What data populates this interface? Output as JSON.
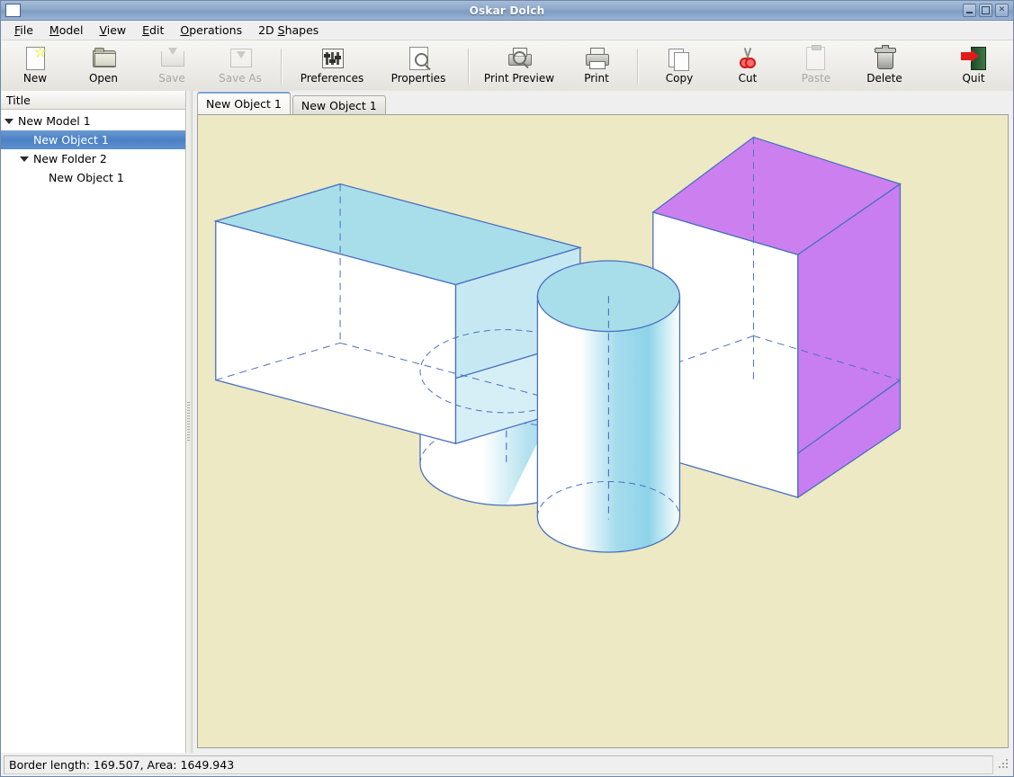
{
  "window": {
    "title": "Oskar Dolch",
    "buttons": [
      {
        "name": "minimize",
        "glyph": "–"
      },
      {
        "name": "maximize",
        "glyph": "□"
      },
      {
        "name": "close",
        "glyph": "✕"
      }
    ]
  },
  "menubar": [
    {
      "label": "File",
      "mnemonic": "F"
    },
    {
      "label": "Model",
      "mnemonic": "M"
    },
    {
      "label": "View",
      "mnemonic": "V"
    },
    {
      "label": "Edit",
      "mnemonic": "E"
    },
    {
      "label": "Operations",
      "mnemonic": "O"
    },
    {
      "label": "2D Shapes",
      "mnemonic": "S"
    }
  ],
  "toolbar": [
    {
      "label": "New",
      "icon": "new-document-icon",
      "enabled": true
    },
    {
      "label": "Open",
      "icon": "open-folder-icon",
      "enabled": true
    },
    {
      "label": "Save",
      "icon": "save-icon",
      "enabled": false
    },
    {
      "label": "Save As",
      "icon": "save-as-icon",
      "enabled": false
    },
    {
      "label": "Preferences",
      "icon": "preferences-icon",
      "enabled": true
    },
    {
      "label": "Properties",
      "icon": "properties-icon",
      "enabled": true
    },
    {
      "label": "Print Preview",
      "icon": "print-preview-icon",
      "enabled": true
    },
    {
      "label": "Print",
      "icon": "printer-icon",
      "enabled": true
    },
    {
      "label": "Copy",
      "icon": "copy-icon",
      "enabled": true
    },
    {
      "label": "Cut",
      "icon": "scissors-icon",
      "enabled": true
    },
    {
      "label": "Paste",
      "icon": "paste-icon",
      "enabled": false
    },
    {
      "label": "Delete",
      "icon": "trash-icon",
      "enabled": true
    },
    {
      "label": "Quit",
      "icon": "quit-door-icon",
      "enabled": true
    }
  ],
  "tree": {
    "header": "Title",
    "items": [
      {
        "label": "New Model 1",
        "depth": 0,
        "expander": "open",
        "selected": false
      },
      {
        "label": "New Object 1",
        "depth": 1,
        "expander": "none",
        "selected": true
      },
      {
        "label": "New Folder 2",
        "depth": 1,
        "expander": "open",
        "selected": false
      },
      {
        "label": "New Object 1",
        "depth": 2,
        "expander": "none",
        "selected": false
      }
    ]
  },
  "tabs": [
    {
      "label": "New Object 1",
      "active": true
    },
    {
      "label": "New Object 1",
      "active": false
    }
  ],
  "statusbar": {
    "text": "Border length: 169.507, Area: 1649.943"
  },
  "colors": {
    "canvas_background": "#ece9c4",
    "outline": "#4a6fc0",
    "cyan_face": "#a8ddea",
    "cyan_light": "#c6e8f2",
    "magenta_face": "#cc80f0",
    "magenta_dark": "#c06ee8",
    "white_face": "#ffffff",
    "selection_blue": "#4a81c4",
    "titlebar_blue": "#8fa9cb"
  }
}
